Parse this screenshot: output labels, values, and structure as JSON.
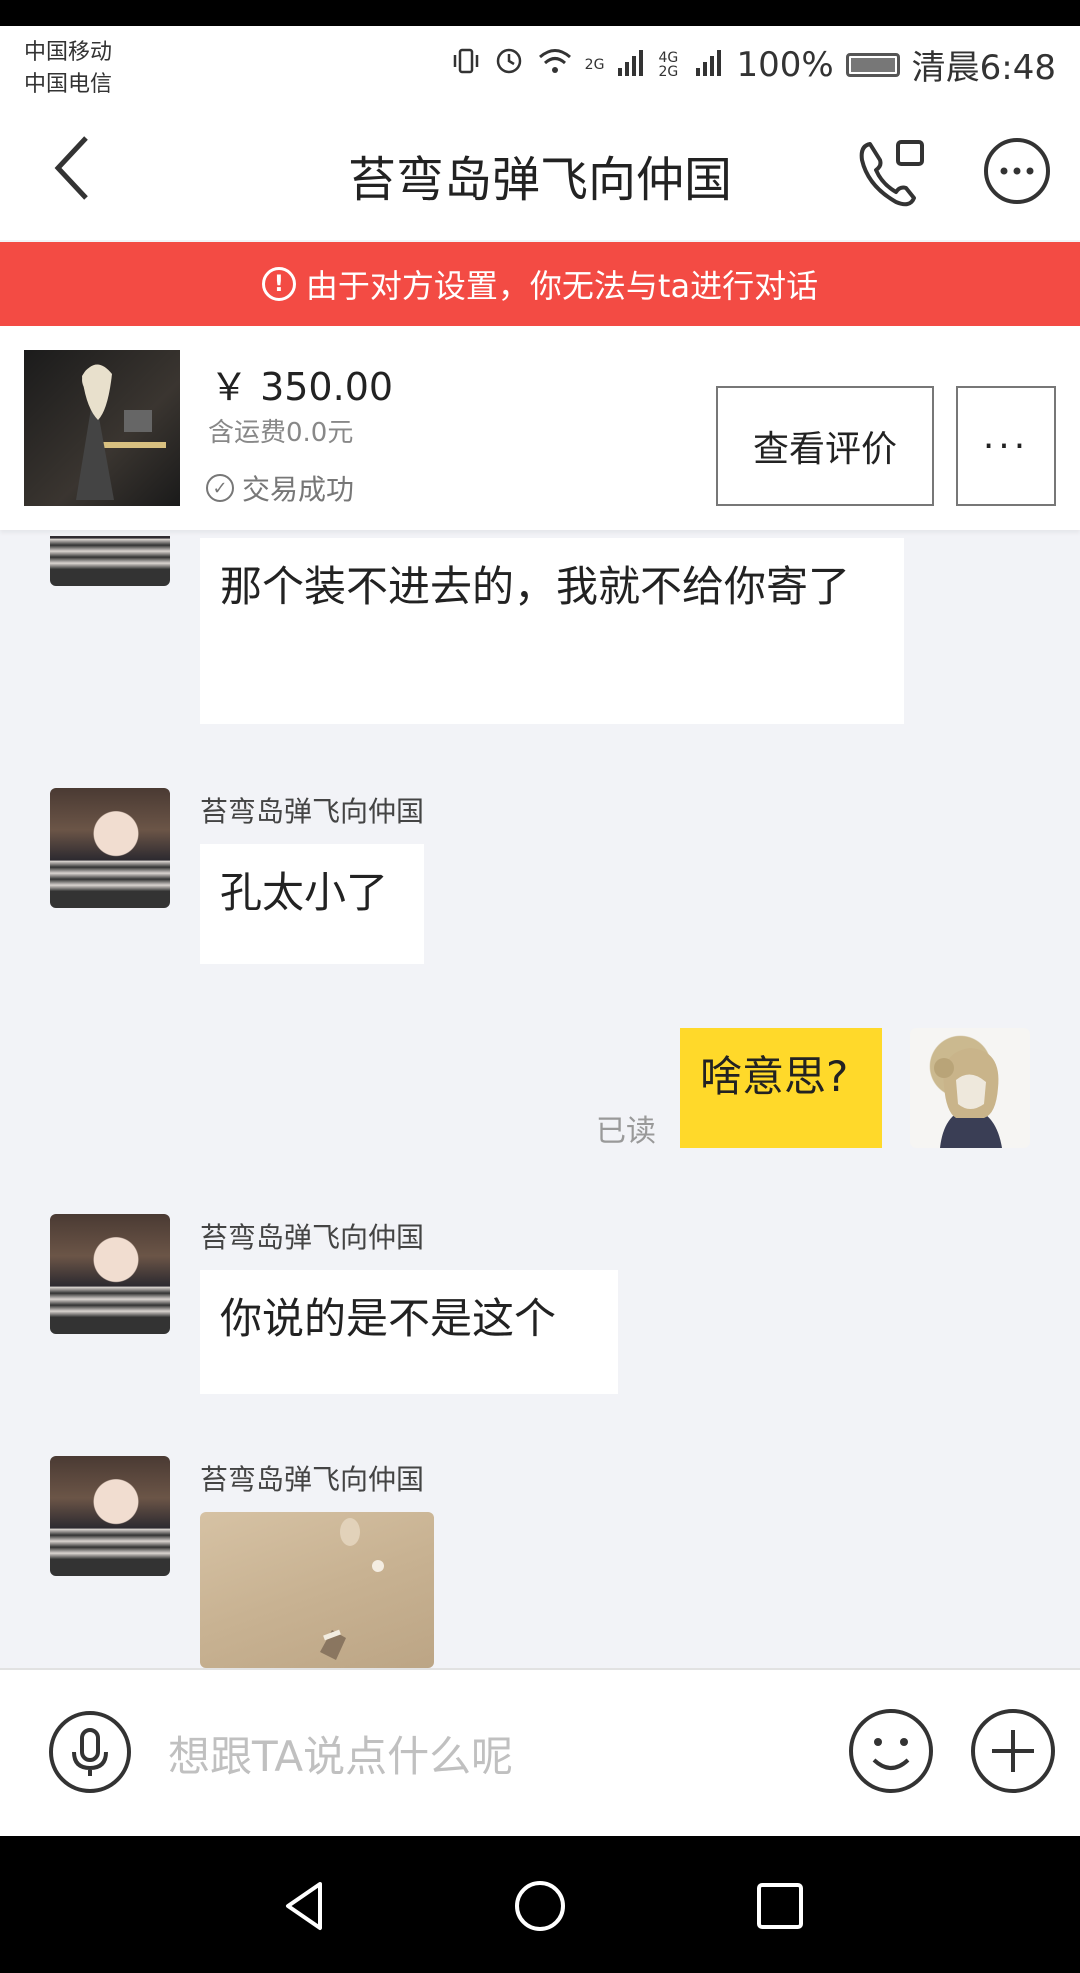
{
  "status_bar": {
    "carrier_1": "中国移动",
    "carrier_2": "中国电信",
    "network": "2G",
    "network_2": "4G 2G",
    "battery": "100%",
    "time": "清晨6:48"
  },
  "header": {
    "title": "苔弯岛弹飞向仲国"
  },
  "warning": {
    "text": "由于对方设置，你无法与ta进行对话"
  },
  "product": {
    "price": "￥ 350.00",
    "shipping": "含运费0.0元",
    "status": "交易成功",
    "review_button": "查看评价",
    "more_button": "···"
  },
  "messages": [
    {
      "from": "other",
      "text": "那个装不进去的，我就不给你寄了"
    },
    {
      "from": "other",
      "sender": "苔弯岛弹飞向仲国",
      "text": "孔太小了"
    },
    {
      "from": "me",
      "text": "啥意思?",
      "read": "已读"
    },
    {
      "from": "other",
      "sender": "苔弯岛弹飞向仲国",
      "text": "你说的是不是这个"
    },
    {
      "from": "other",
      "sender": "苔弯岛弹飞向仲国",
      "type": "image"
    }
  ],
  "input": {
    "placeholder": "想跟TA说点什么呢"
  },
  "colors": {
    "warning_bg": "#f34b44",
    "my_bubble": "#ffd92a",
    "chat_bg": "#f2f3f7"
  },
  "icons": [
    "back-arrow-icon",
    "video-call-icon",
    "more-icon",
    "warning-icon",
    "check-circle-icon",
    "mic-icon",
    "emoji-icon",
    "plus-icon",
    "nav-back-icon",
    "nav-home-icon",
    "nav-recent-icon"
  ]
}
